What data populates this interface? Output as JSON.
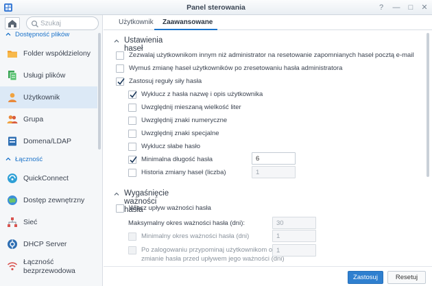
{
  "window": {
    "title": "Panel sterowania",
    "help_glyph": "?",
    "minimize_glyph": "—",
    "maximize_glyph": "□",
    "close_glyph": "✕"
  },
  "colors": {
    "accent": "#1a72c9",
    "active_item_bg": "#dce9f6",
    "primary_button": "#2f7fcf"
  },
  "sidebar": {
    "search_placeholder": "Szukaj",
    "sections": [
      {
        "label": "Dostępność plików",
        "items": [
          {
            "label": "Folder współdzielony",
            "icon": "folder-icon"
          },
          {
            "label": "Usługi plików",
            "icon": "file-services-icon"
          },
          {
            "label": "Użytkownik",
            "icon": "user-icon",
            "active": true
          },
          {
            "label": "Grupa",
            "icon": "group-icon"
          },
          {
            "label": "Domena/LDAP",
            "icon": "domain-icon"
          }
        ]
      },
      {
        "label": "Łączność",
        "items": [
          {
            "label": "QuickConnect",
            "icon": "quickconnect-icon"
          },
          {
            "label": "Dostęp zewnętrzny",
            "icon": "globe-icon"
          },
          {
            "label": "Sieć",
            "icon": "network-icon"
          },
          {
            "label": "DHCP Server",
            "icon": "dhcp-icon"
          },
          {
            "label": "Łączność bezprzewodowa",
            "icon": "wifi-icon"
          }
        ]
      }
    ]
  },
  "tabs": [
    {
      "label": "Użytkownik",
      "active": false
    },
    {
      "label": "Zaawansowane",
      "active": true
    }
  ],
  "password_settings": {
    "title": "Ustawienia haseł",
    "allow_reset": {
      "label": "Zezwalaj użytkownikom innym niż administrator na resetowanie zapomnianych haseł pocztą e-mail",
      "checked": false
    },
    "force_change": {
      "label": "Wymuś zmianę haseł użytkowników po zresetowaniu hasła administratora",
      "checked": false
    },
    "apply_rules": {
      "label": "Zastosuj reguły siły hasła",
      "checked": true
    },
    "rules": [
      {
        "label": "Wyklucz z hasła nazwę i opis użytkownika",
        "checked": true
      },
      {
        "label": "Uwzględnij mieszaną wielkość liter",
        "checked": false
      },
      {
        "label": "Uwzględnij znaki numeryczne",
        "checked": false
      },
      {
        "label": "Uwzględnij znaki specjalne",
        "checked": false
      },
      {
        "label": "Wyklucz słabe hasło",
        "checked": false
      }
    ],
    "min_length": {
      "label": "Minimalna długość hasła",
      "checked": true,
      "value": "6"
    },
    "history": {
      "label": "Historia zmiany haseł (liczba)",
      "checked": false,
      "value": "1"
    }
  },
  "expiry": {
    "title": "Wygaśnięcie ważności hasła",
    "enable": {
      "label": "Włącz upływ ważności hasła",
      "checked": false
    },
    "max_age": {
      "label": "Maksymalny okres ważności hasła (dni):",
      "value": "30"
    },
    "min_age": {
      "label": "Minimalny okres ważności hasła (dni)",
      "value": "1"
    },
    "remind": {
      "label_line1": "Po zalogowaniu przypominaj użytkownikom o",
      "label_line2": "zmianie hasła przed upływem jego ważności (dni)",
      "value": "1"
    }
  },
  "footer": {
    "apply_label": "Zastosuj",
    "reset_label": "Resetuj"
  }
}
